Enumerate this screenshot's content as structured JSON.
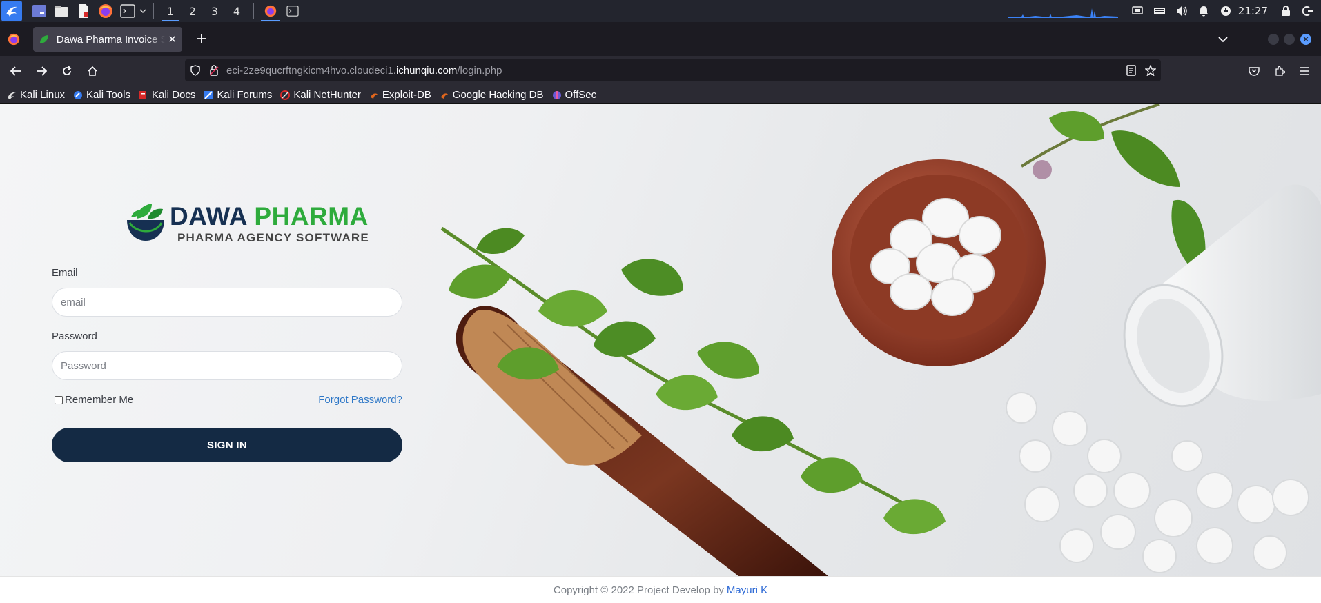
{
  "taskbar": {
    "workspaces": [
      "1",
      "2",
      "3",
      "4"
    ],
    "active_workspace": "1",
    "clock": "21:27"
  },
  "browser": {
    "tab_title": "Dawa Pharma Invoice System",
    "url_prefix": "eci-2ze9qucrftngkicm4hvo.cloudeci1.",
    "url_host": "ichunqiu.com",
    "url_path": "/login.php"
  },
  "bookmarks": [
    {
      "label": "Kali Linux",
      "icon": "kali-dragon-icon",
      "color": "#1a1a1a"
    },
    {
      "label": "Kali Tools",
      "icon": "kali-tools-icon",
      "color": "#367bf0"
    },
    {
      "label": "Kali Docs",
      "icon": "kali-docs-icon",
      "color": "#d62828"
    },
    {
      "label": "Kali Forums",
      "icon": "kali-forums-icon",
      "color": "#367bf0"
    },
    {
      "label": "Kali NetHunter",
      "icon": "nethunter-icon",
      "color": "#d62828"
    },
    {
      "label": "Exploit-DB",
      "icon": "exploit-db-icon",
      "color": "#e0661d"
    },
    {
      "label": "Google Hacking DB",
      "icon": "ghdb-icon",
      "color": "#e0661d"
    },
    {
      "label": "OffSec",
      "icon": "offsec-icon",
      "color": "#6a5ad6"
    }
  ],
  "login": {
    "logo_word1": "DAWA",
    "logo_word2": "PHARMA",
    "logo_sub": "PHARMA AGENCY SOFTWARE",
    "email_label": "Email",
    "email_placeholder": "email",
    "password_label": "Password",
    "password_placeholder": "Password",
    "remember_label": "Remember Me",
    "forgot_label": "Forgot Password?",
    "signin_label": "SIGN IN"
  },
  "footer": {
    "text": "Copyright © 2022 Project Develop by",
    "author": "Mayuri K"
  },
  "colors": {
    "accent": "#142a44",
    "brand_green": "#2eab3c",
    "link": "#2f78c7"
  }
}
